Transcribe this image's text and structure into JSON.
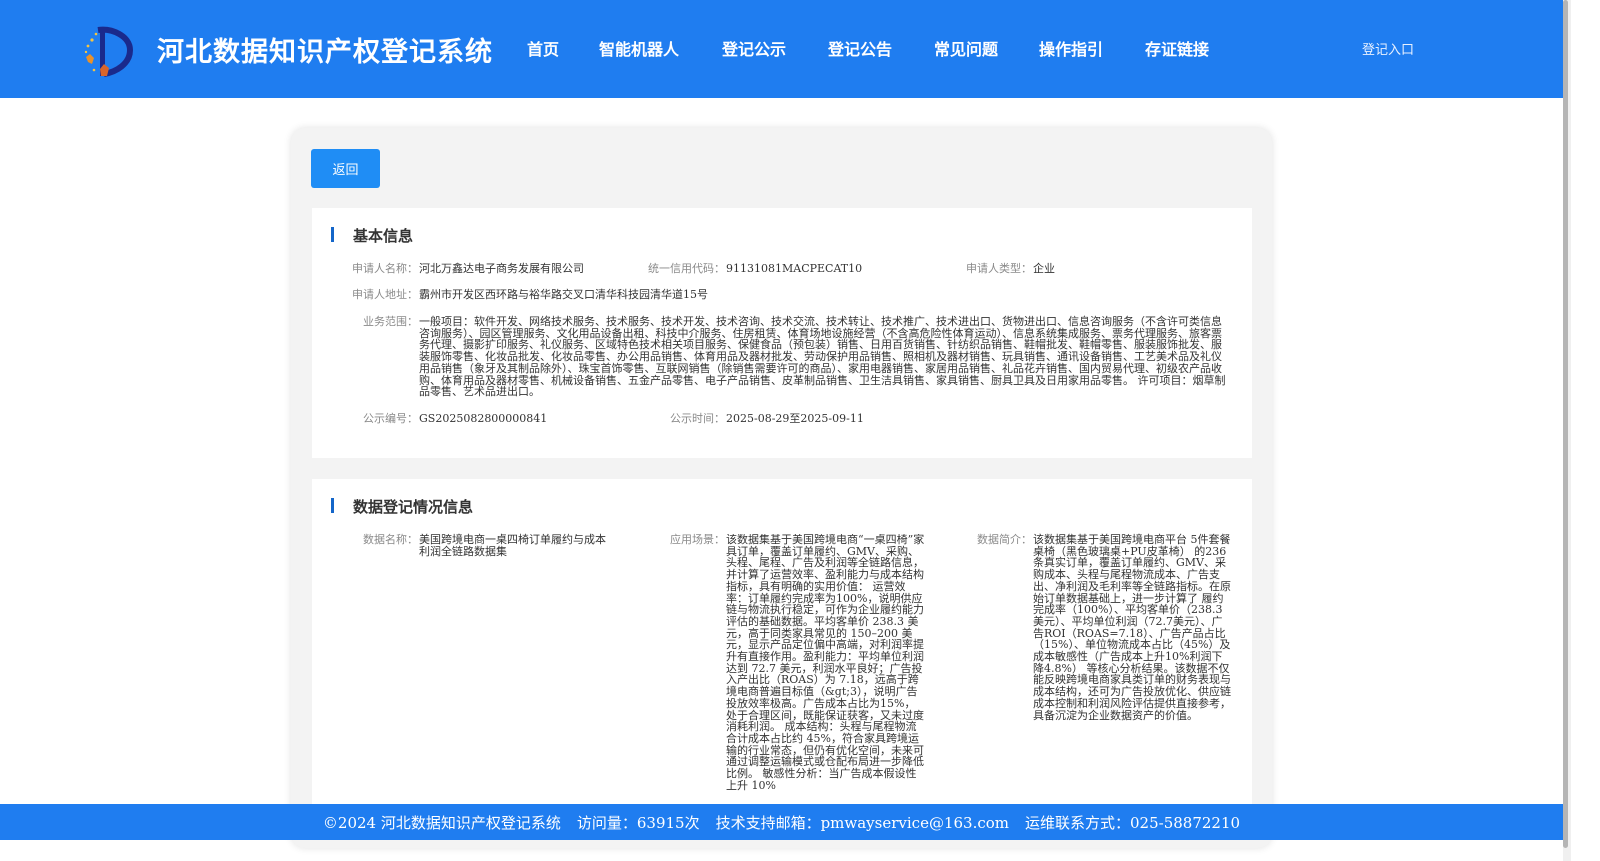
{
  "header": {
    "site_title": "河北数据知识产权登记系统",
    "nav": [
      {
        "label": "首页"
      },
      {
        "label": "智能机器人"
      },
      {
        "label": "登记公示"
      },
      {
        "label": "登记公告"
      },
      {
        "label": "常见问题"
      },
      {
        "label": "操作指引"
      },
      {
        "label": "存证链接"
      }
    ],
    "login_label": "登记入口",
    "color": "#1f7df0"
  },
  "actions": {
    "back_label": "返回"
  },
  "basic_info": {
    "section_title": "基本信息",
    "applicant_name_label": "申请人名称：",
    "applicant_name": "河北万鑫达电子商务发展有限公司",
    "credit_code_label": "统一信用代码：",
    "credit_code": "91131081MACPECAT10",
    "applicant_type_label": "申请人类型：",
    "applicant_type": "企业",
    "address_label": "申请人地址：",
    "address": "霸州市开发区西环路与裕华路交叉口清华科技园清华道15号",
    "business_scope_label": "业务范围：",
    "business_scope": "一般项目：软件开发、网络技术服务、技术服务、技术开发、技术咨询、技术交流、技术转让、技术推广、技术进出口、货物进出口、信息咨询服务（不含许可类信息咨询服务）、园区管理服务、文化用品设备出租、科技中介服务、住房租赁、体育场地设施经营（不含高危险性体育运动）、信息系统集成服务、票务代理服务、旅客票务代理、摄影扩印服务、礼仪服务、区域特色技术相关项目服务、保健食品（预包装）销售、日用百货销售、针纺织品销售、鞋帽批发、鞋帽零售、服装服饰批发、服装服饰零售、化妆品批发、化妆品零售、办公用品销售、体育用品及器材批发、劳动保护用品销售、照相机及器材销售、玩具销售、通讯设备销售、工艺美术品及礼仪用品销售（象牙及其制品除外）、珠宝首饰零售、互联网销售（除销售需要许可的商品）、家用电器销售、家居用品销售、礼品花卉销售、国内贸易代理、初级农产品收购、体育用品及器材零售、机械设备销售、五金产品零售、电子产品销售、皮革制品销售、卫生洁具销售、家具销售、厨具卫具及日用家用品零售。 许可项目：烟草制品零售、艺术品进出口。",
    "notice_no_label": "公示编号：",
    "notice_no": "GS2025082800000841",
    "notice_time_label": "公示时间：",
    "notice_time": "2025-08-29至2025-09-11"
  },
  "data_info": {
    "section_title": "数据登记情况信息",
    "data_name_label": "数据名称：",
    "data_name": "美国跨境电商一桌四椅订单履约与成本利润全链路数据集",
    "scenario_label": "应用场景：",
    "scenario": "该数据集基于美国跨境电商“一桌四椅”家具订单，覆盖订单履约、GMV、采购、头程、尾程、广告及利润等全链路信息，并计算了运营效率、盈利能力与成本结构指标，具有明确的实用价值： 运营效率：订单履约完成率为100%，说明供应链与物流执行稳定，可作为企业履约能力评估的基础数据。平均客单价 238.3 美元，高于同类家具常见的 150–200 美元，显示产品定位偏中高端，对利润率提升有直接作用。盈利能力：平均单位利润达到 72.7 美元，利润水平良好；广告投入产出比（ROAS）为 7.18，远高于跨境电商普遍目标值（&gt;3），说明广告投放效率极高。广告成本占比为15%，处于合理区间，既能保证获客，又未过度消耗利润。 成本结构：头程与尾程物流合计成本占比约 45%，符合家具跨境运输的行业常态，但仍有优化空间，未来可通过调整运输模式或仓配布局进一步降低比例。 敏感性分析：当广告成本假设性上升 10%",
    "summary_label": "数据简介：",
    "summary": "该数据集基于美国跨境电商平台 5件套餐桌椅（黑色玻璃桌+PU皮革椅） 的236条真实订单，覆盖订单履约、GMV、采购成本、头程与尾程物流成本、广告支出、净利润及毛利率等全链路指标。在原始订单数据基础上，进一步计算了 履约完成率（100%）、平均客单价（238.3美元）、平均单位利润（72.7美元）、广告ROI（ROAS=7.18）、广告产品占比（15%）、单位物流成本占比（45%）及 成本敏感性（广告成本上升10%利润下降4.8%） 等核心分析结果。该数据不仅能反映跨境电商家具类订单的财务表现与成本结构，还可为广告投放优化、供应链成本控制和利润风险评估提供直接参考，具备沉淀为企业数据资产的价值。"
  },
  "footer": {
    "copyright": "©2024 河北数据知识产权登记系统",
    "visits": "访问量：63915次",
    "email": "技术支持邮箱：pmwayservice@163.com",
    "phone": "运维联系方式：025-58872210"
  }
}
